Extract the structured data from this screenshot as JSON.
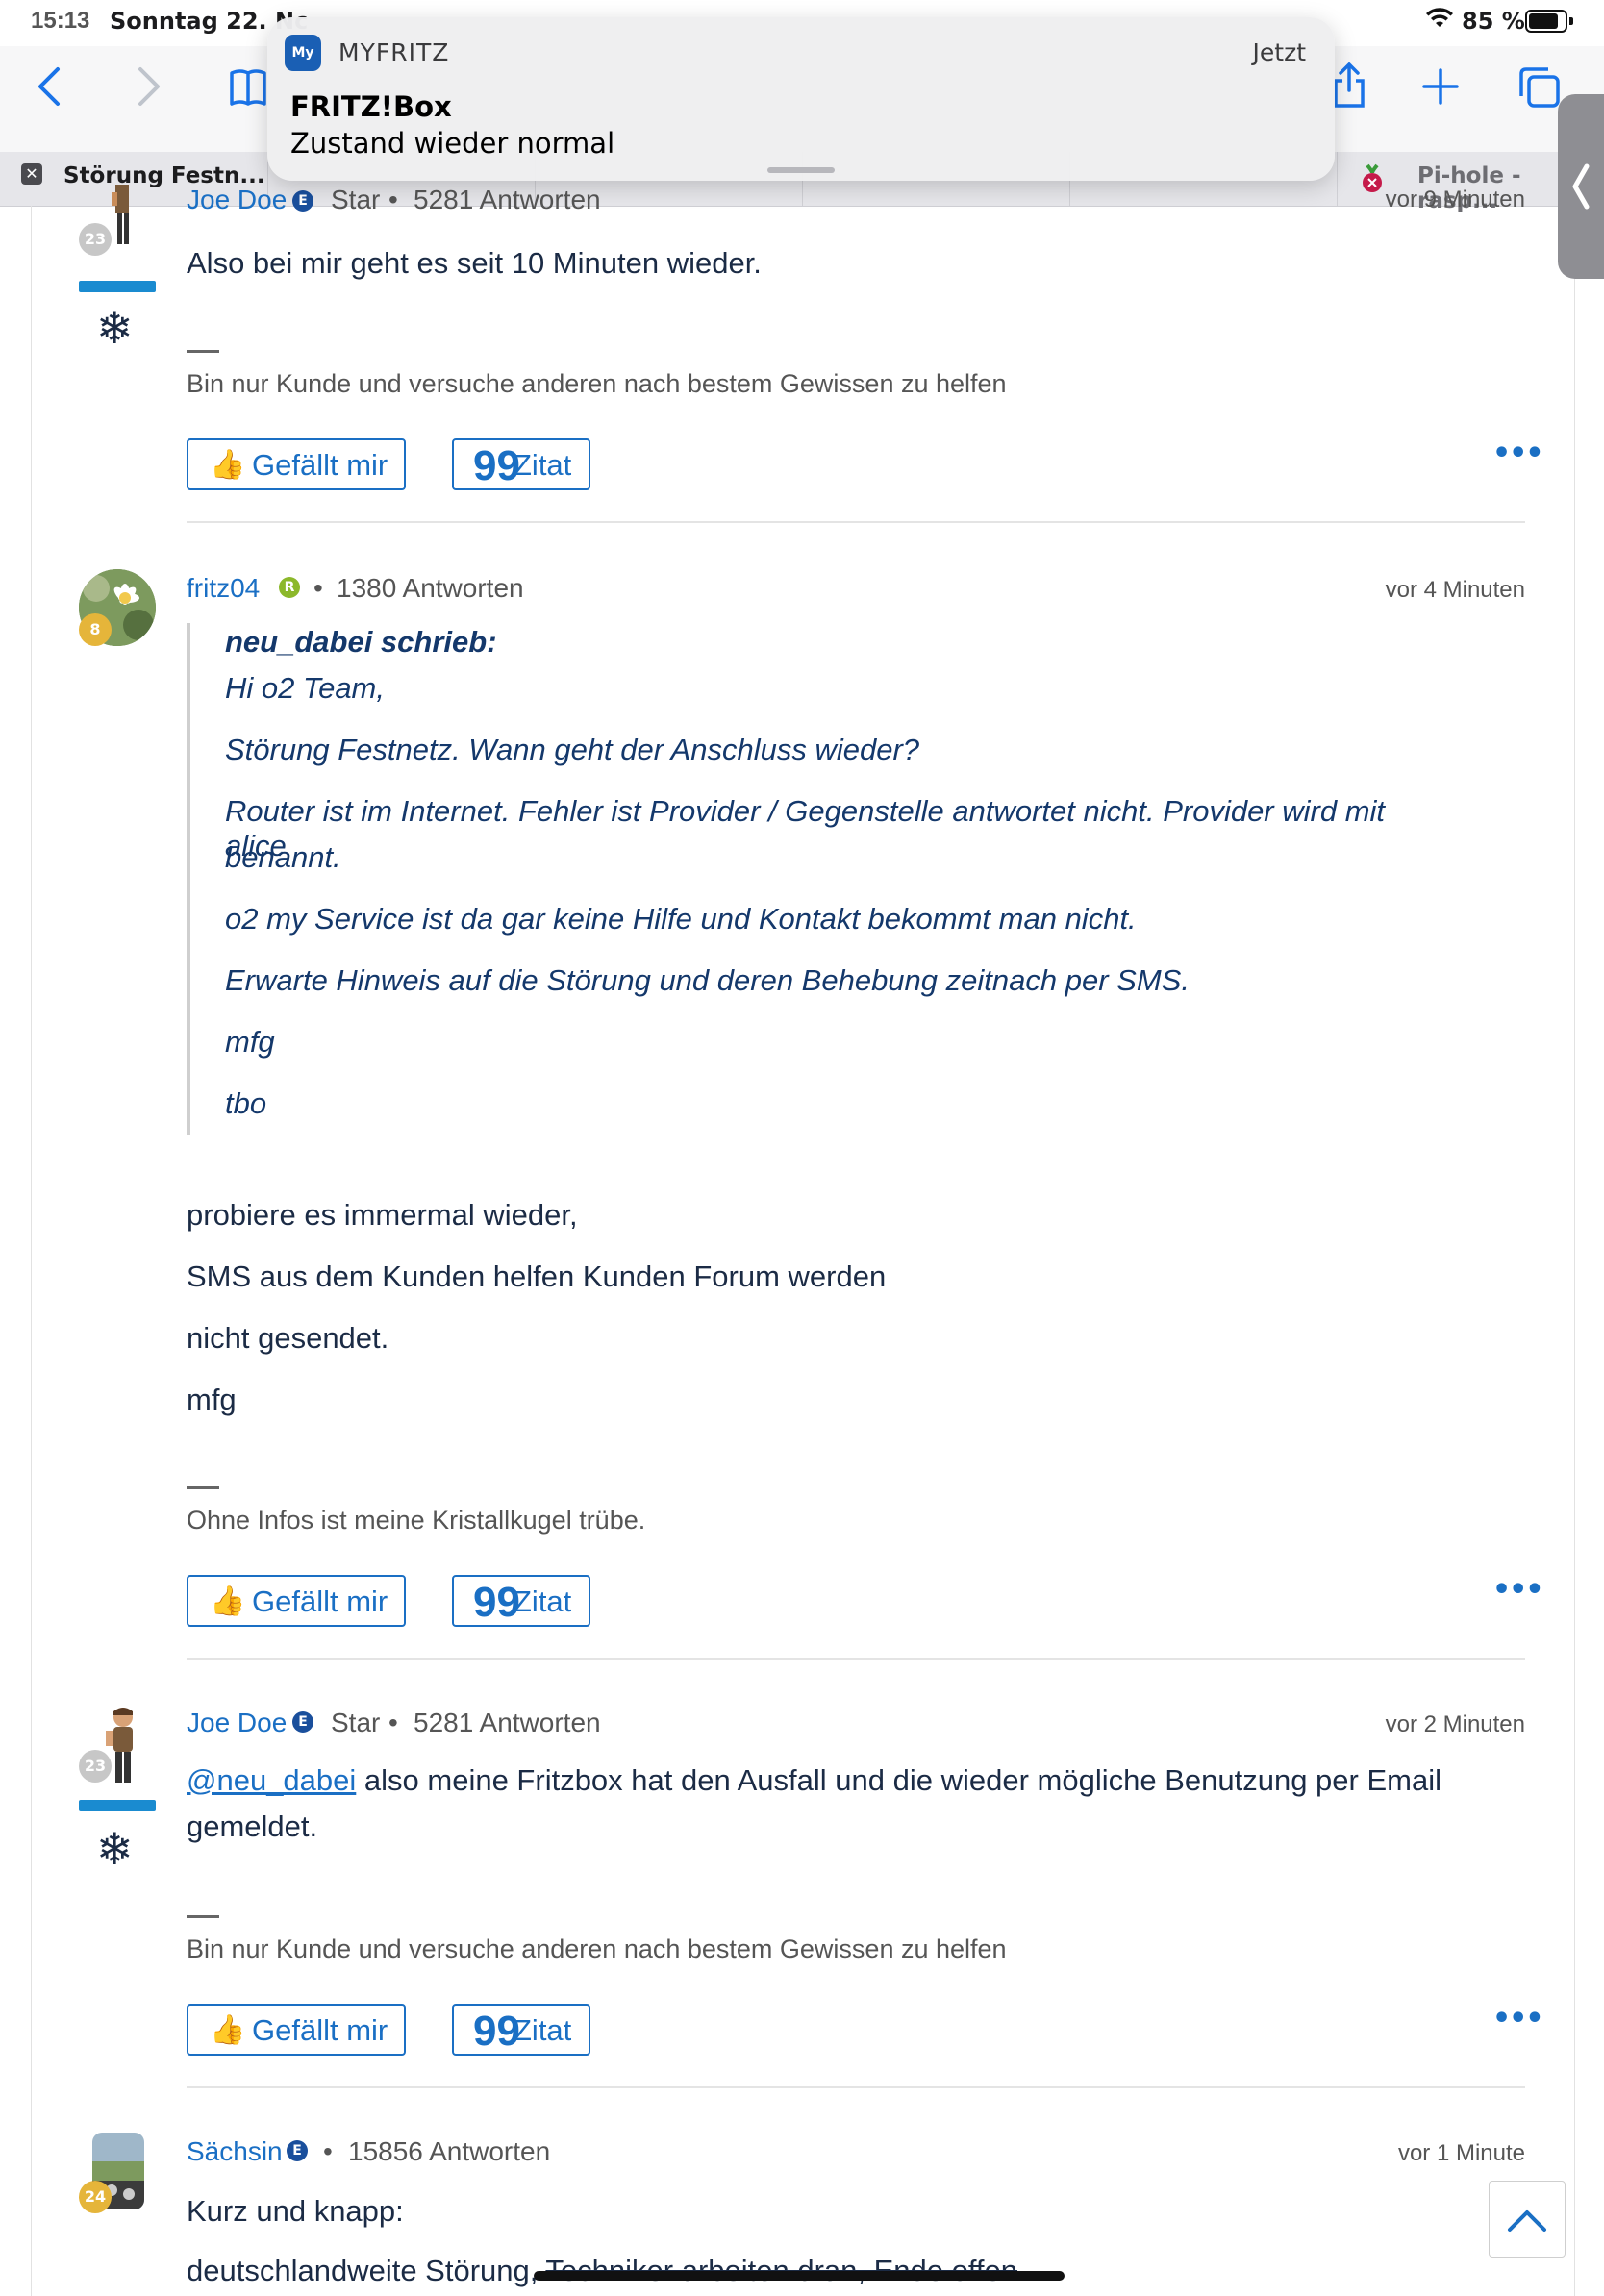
{
  "status_bar": {
    "time": "15:13",
    "date": "Sonntag 22. Nc",
    "battery": "85 %"
  },
  "tabs": [
    {
      "label": "Störung Festn..."
    },
    {
      "label": "Pi-hole - rasp..."
    }
  ],
  "notification": {
    "app": "MYFRITZ",
    "app_icon_text": "My",
    "when": "Jetzt",
    "title": "FRITZ!Box",
    "body": "Zustand wieder normal"
  },
  "posts": {
    "p0": {
      "author": "Joe Doe",
      "rank": "Star",
      "sep": "•",
      "answers": "5281 Antworten",
      "time": "vor 9 Minuten",
      "level": "23",
      "text": "Also bei mir geht es seit 10 Minuten wieder.",
      "signature": "Bin nur Kunde und versuche anderen nach bestem Gewissen zu helfen"
    },
    "p1": {
      "author": "fritz04",
      "badge": "R",
      "sep": "•",
      "answers": "1380 Antworten",
      "time": "vor 4 Minuten",
      "level": "8",
      "quote_author": "neu_dabei schrieb:",
      "quote_lines": [
        "Hi o2 Team,",
        "Störung Festnetz. Wann geht der Anschluss wieder?",
        "Router ist im Internet. Fehler ist Provider / Gegenstelle antwortet nicht. Provider wird mit alice",
        "benannt.",
        "o2 my Service ist da gar keine Hilfe und Kontakt bekommt man nicht.",
        "Erwarte Hinweis auf die Störung und deren Behebung zeitnach per SMS.",
        "mfg",
        "tbo"
      ],
      "body_lines": [
        "probiere es immermal wieder,",
        "SMS aus dem Kunden helfen Kunden Forum werden",
        "nicht gesendet.",
        "mfg"
      ],
      "signature": "Ohne Infos ist meine Kristallkugel trübe."
    },
    "p2": {
      "author": "Joe Doe",
      "badge": "E",
      "rank": "Star",
      "sep": "•",
      "answers": "5281 Antworten",
      "time": "vor 2 Minuten",
      "level": "23",
      "mention": "@neu_dabei",
      "text_rest": " also meine Fritzbox hat den Ausfall und die wieder mögliche Benutzung per Email",
      "text_line2": "gemeldet.",
      "signature": "Bin nur Kunde und versuche anderen nach bestem Gewissen zu helfen"
    },
    "p3": {
      "author": "Sächsin",
      "badge": "E",
      "sep": "•",
      "answers": "15856 Antworten",
      "time": "vor 1 Minute",
      "level": "24",
      "line1": "Kurz und knapp:",
      "line2_plain": "deutschlandweite Störung, ",
      "line2_struck": "Techniker arbeiten dran, Ende offen"
    }
  },
  "actions": {
    "like": "Gefällt mir",
    "quote": "Zitat",
    "quote_icon": "99",
    "more": "•••"
  },
  "colors": {
    "accent": "#1a6fc4",
    "quote_text": "#14386b",
    "body_text": "#1b2b45",
    "level_badge": "#e5b53a"
  }
}
